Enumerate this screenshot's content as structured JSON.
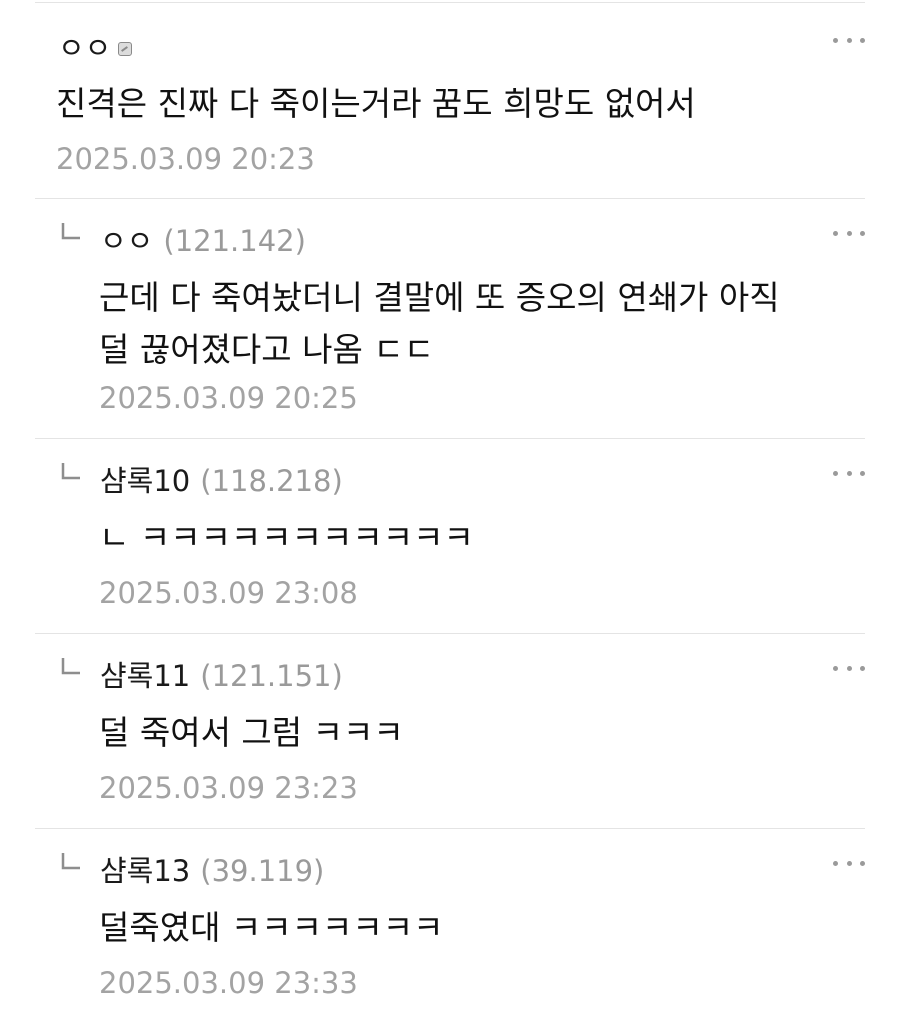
{
  "comments": [
    {
      "nickname": "ㅇㅇ",
      "ip": "",
      "body_lines": [
        "진격은 진짜 다 죽이는거라 꿈도 희망도 없어서"
      ],
      "time": "2025.03.09 20:23",
      "icons": [
        "reply-arrow-icon",
        "more-options-icon",
        "fixed-nick-icon"
      ]
    },
    {
      "nickname": "ㅇㅇ",
      "ip": "(121.142)",
      "body_lines": [
        "근데 다 죽여놨더니 결말에 또 증오의 연쇄가 아직",
        "덜 끊어졌다고 나옴 ㄷㄷ"
      ],
      "time": "2025.03.09 20:25"
    },
    {
      "nickname": "샴록10",
      "ip": "(118.218)",
      "body_lines": [
        "ㄴ ㅋㅋㅋㅋㅋㅋㅋㅋㅋㅋㅋ"
      ],
      "time": "2025.03.09 23:08"
    },
    {
      "nickname": "샴록11",
      "ip": "(121.151)",
      "body_lines": [
        "덜 죽여서 그럼 ㅋㅋㅋ"
      ],
      "time": "2025.03.09 23:23"
    },
    {
      "nickname": "샴록13",
      "ip": "(39.119)",
      "body_lines": [
        "덜죽였대 ㅋㅋㅋㅋㅋㅋㅋ"
      ],
      "time": "2025.03.09 23:33"
    }
  ]
}
